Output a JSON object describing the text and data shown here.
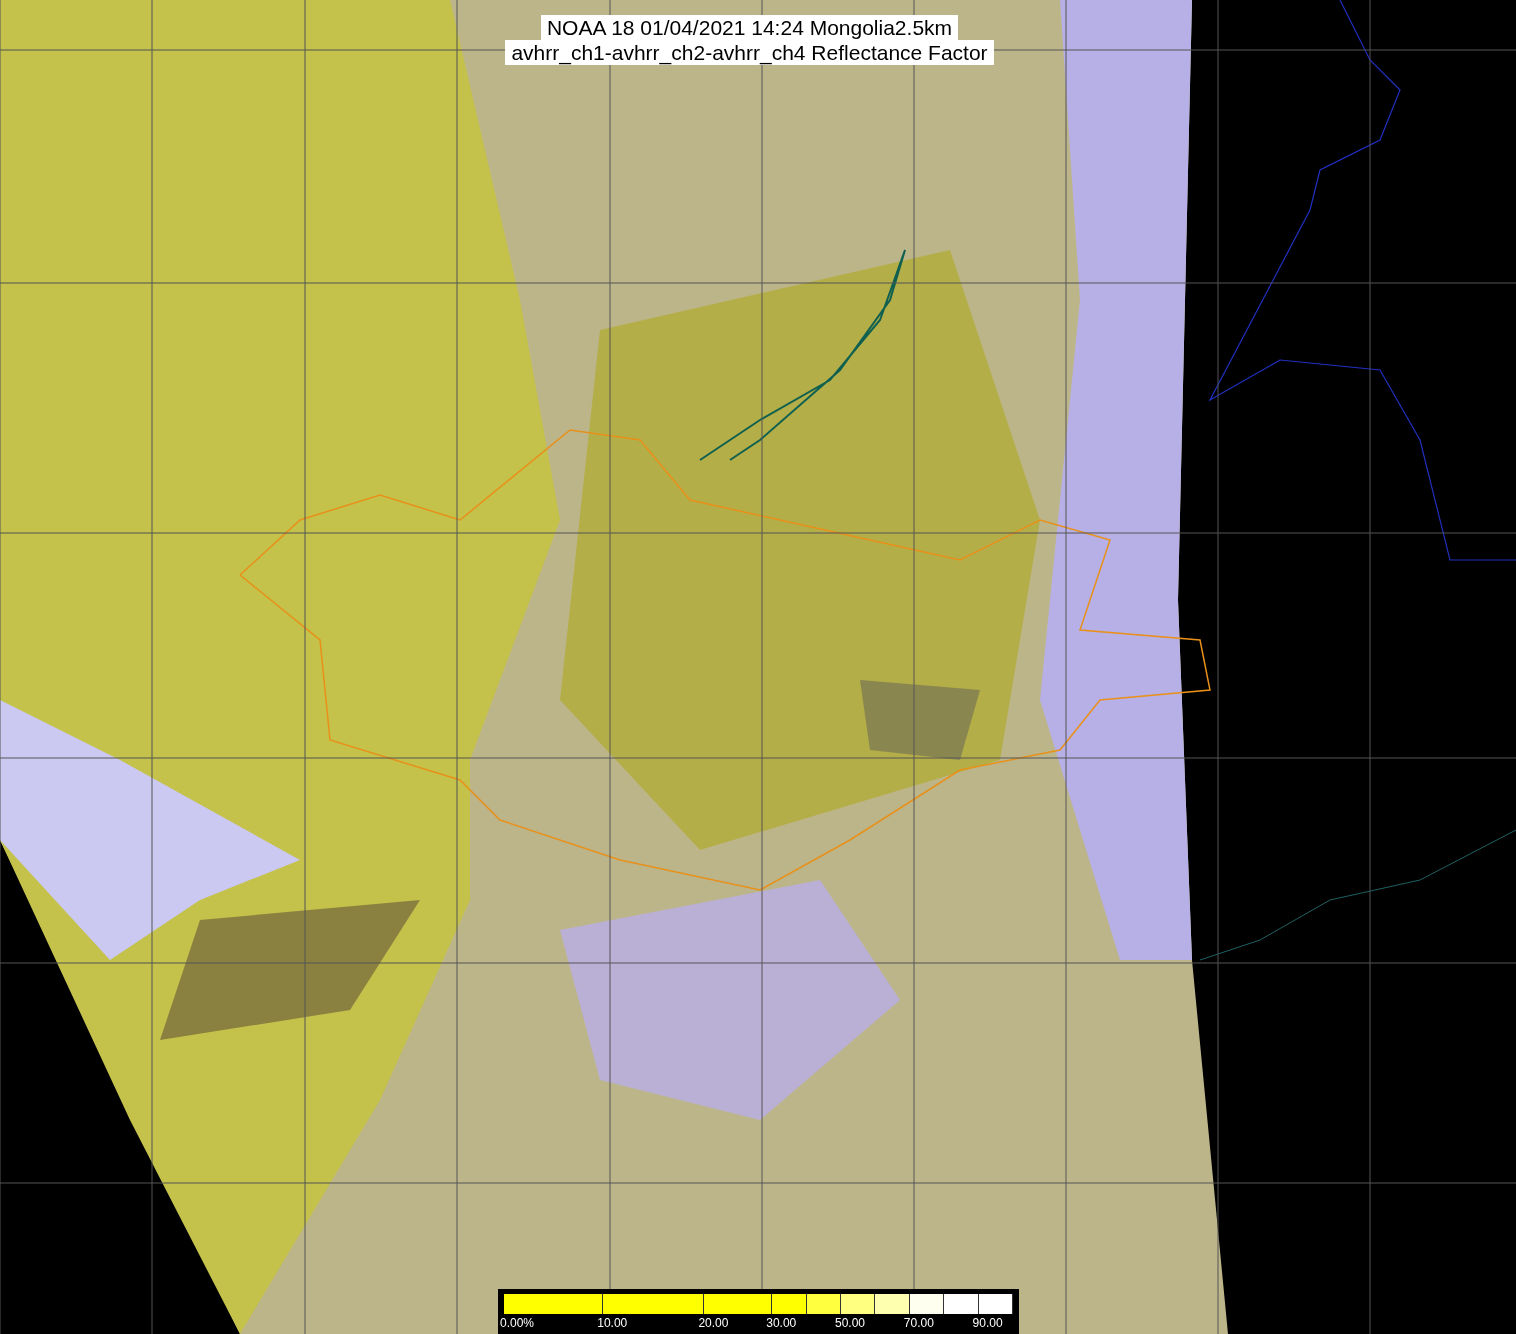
{
  "title": {
    "lines": [
      "NOAA 18 01/04/2021 14:24 Mongolia2.5km",
      "avhrr_ch1-avhrr_ch2-avhrr_ch4 Reflectance Factor"
    ]
  },
  "colorbar": {
    "segments": [
      {
        "color": "#ffff00",
        "label": "0.00%"
      },
      {
        "color": "#ffff00",
        "label": "10.00"
      },
      {
        "color": "#ffff00",
        "label": "20.00"
      },
      {
        "color": "#ffff00",
        "label": "30.00"
      },
      {
        "color": "#ffff40"
      },
      {
        "color": "#ffff80",
        "label": "50.00"
      },
      {
        "color": "#ffffb0"
      },
      {
        "color": "#fffff0",
        "label": "70.00"
      },
      {
        "color": "#ffffff"
      },
      {
        "color": "#ffffff",
        "label": "90.00"
      }
    ]
  }
}
